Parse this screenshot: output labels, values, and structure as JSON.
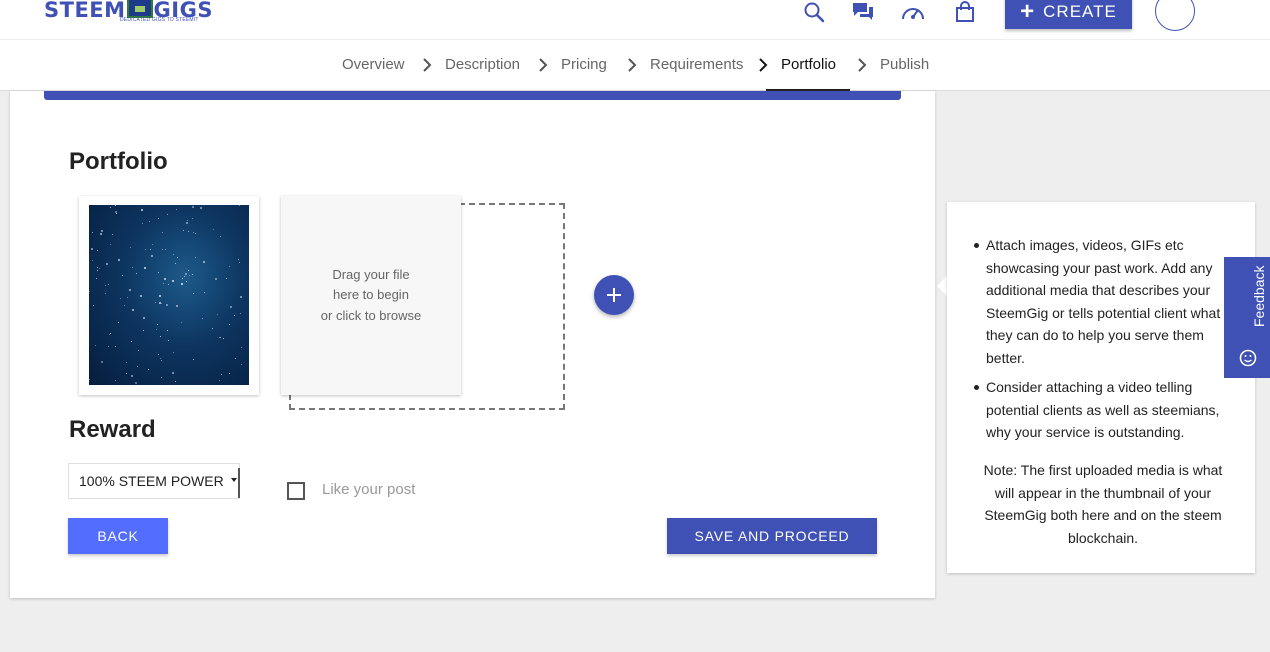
{
  "header": {
    "logo_left": "STEEM",
    "logo_right": "GIGS",
    "tagline": "DEDICATED GIGS TO STEEMIT",
    "create_label": "CREATE",
    "icons": [
      "search-icon",
      "chat-icon",
      "speedometer-icon",
      "shopping-bag-icon",
      "plus-icon"
    ]
  },
  "stepper": {
    "steps": [
      {
        "label": "Overview"
      },
      {
        "label": "Description"
      },
      {
        "label": "Pricing"
      },
      {
        "label": "Requirements"
      },
      {
        "label": "Portfolio"
      },
      {
        "label": "Publish"
      }
    ],
    "active": "Portfolio"
  },
  "portfolio": {
    "title": "Portfolio",
    "dropzone_line1": "Drag your file",
    "dropzone_line2": "here to begin",
    "dropzone_line3": "or click to browse"
  },
  "reward": {
    "title": "Reward",
    "selected": "100% STEEM POWER",
    "like_label": "Like your post",
    "like_checked": false
  },
  "actions": {
    "back_label": "BACK",
    "save_label": "SAVE AND PROCEED"
  },
  "tips": {
    "tip1": "Attach images, videos, GIFs etc showcasing your past work. Add any additional media that describes your SteemGig or tells potential client what they can do to help you serve them better.",
    "tip2": "Consider attaching a video telling potential clients as well as steemians, why your service is outstanding.",
    "note": "Note: The first uploaded media is what will appear in the thumbnail of your SteemGig both here and on the steem blockchain."
  },
  "feedback": {
    "label": "Feedback"
  },
  "colors": {
    "primary": "#3f51b5",
    "accent": "#536dfe",
    "background": "#eeeeee"
  }
}
